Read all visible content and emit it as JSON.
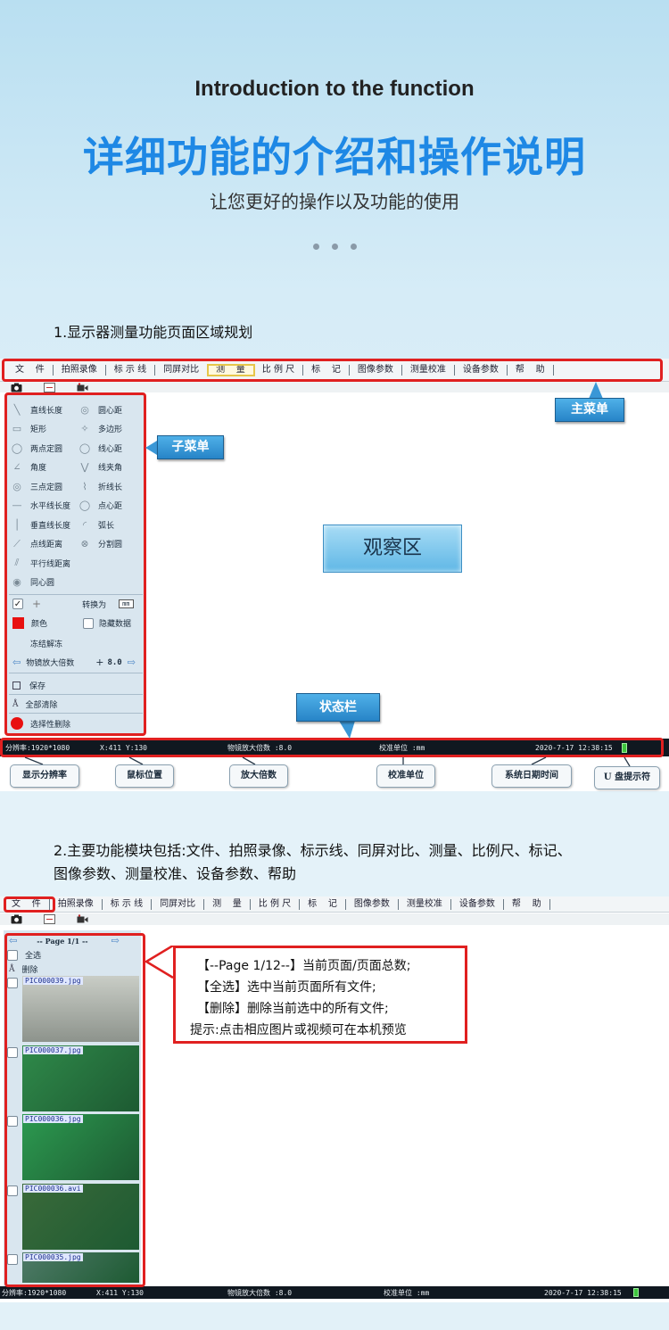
{
  "header": {
    "title_en": "Introduction to the function",
    "title_cn": "详细功能的介绍和操作说明",
    "subtitle": "让您更好的操作以及功能的使用"
  },
  "section1": {
    "title": "1.显示器测量功能页面区域规划",
    "menu": [
      "文    件",
      "拍照录像",
      "标 示 线",
      "同屏对比",
      "测    量",
      "比 例 尺",
      "标    记",
      "图像参数",
      "测量校准",
      "设备参数",
      "帮    助"
    ],
    "callouts": {
      "main_menu": "主菜单",
      "sub_menu": "子菜单",
      "observation": "观察区",
      "status_bar": "状态栏"
    },
    "measure_items": [
      [
        "直线长度",
        "圆心距"
      ],
      [
        "矩形",
        "多边形"
      ],
      [
        "两点定圆",
        "线心距"
      ],
      [
        "角度",
        "线夹角"
      ],
      [
        "三点定圆",
        "折线长"
      ],
      [
        "水平线长度",
        "点心距"
      ],
      [
        "垂直线长度",
        "弧长"
      ],
      [
        "点线距离",
        "分割圆"
      ],
      [
        "平行线距离",
        ""
      ],
      [
        "同心圆",
        ""
      ]
    ],
    "options": {
      "convert_label": "转换为",
      "convert_unit": "mm",
      "color_label": "颜色",
      "hide_data_label": "隐藏数据",
      "freeze_label": "冻结解冻",
      "mag_label": "物镜放大倍数",
      "mag_value": "8.0",
      "save_label": "保存",
      "clear_all_label": "全部清除",
      "selective_delete_label": "选择性删除"
    },
    "status": {
      "resolution": "分辨率:1920*1080",
      "position": "X:411 Y:130",
      "mag": "物镜放大倍数   :8.0",
      "unit": "校准单位   :mm",
      "datetime": "2020-7-17 12:38:15"
    },
    "status_labels": [
      "显示分辨率",
      "鼠标位置",
      "放大倍数",
      "校准单位",
      "系统日期时间",
      "U 盘提示符"
    ]
  },
  "section2": {
    "title_line1": "2.主要功能模块包括:文件、拍照录像、标示线、同屏对比、测量、比例尺、标记、",
    "title_line2": "图像参数、测量校准、设备参数、帮助",
    "page_label": "--  Page 1/1  --",
    "select_all": "全选",
    "delete": "删除",
    "files": [
      "PIC000039.jpg",
      "PIC000037.jpg",
      "PIC000036.jpg",
      "PIC000036.avi",
      "PIC000035.jpg"
    ],
    "explain": [
      "【--Page 1/12--】当前页面/页面总数;",
      "【全选】选中当前页面所有文件;",
      "【删除】删除当前选中的所有文件;",
      "提示:点击相应图片或视频可在本机预览"
    ]
  },
  "colors": {
    "accent_blue": "#1e88e5",
    "highlight_red": "#e02020",
    "status_dark": "#101820"
  }
}
